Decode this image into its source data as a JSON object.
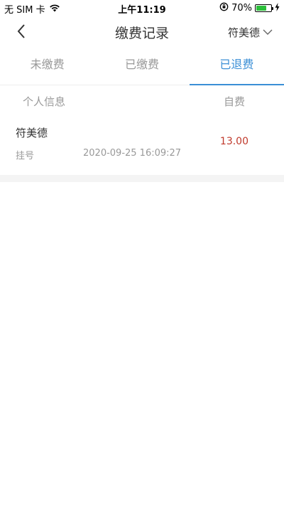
{
  "status_bar": {
    "carrier": "无 SIM 卡",
    "time": "上午11:19",
    "battery_percent": "70%",
    "battery_level": 0.7
  },
  "nav": {
    "title": "缴费记录",
    "patient_name": "符美德"
  },
  "tabs": [
    {
      "label": "未缴费",
      "active": false
    },
    {
      "label": "已缴费",
      "active": false
    },
    {
      "label": "已退费",
      "active": true
    }
  ],
  "list_header": {
    "left": "个人信息",
    "right": "自费"
  },
  "records": [
    {
      "name": "符美德",
      "type": "挂号",
      "time": "2020-09-25 16:09:27",
      "amount": "13.00"
    }
  ],
  "colors": {
    "accent": "#3b8fd6",
    "amount": "#c0392b",
    "muted": "#999999"
  }
}
